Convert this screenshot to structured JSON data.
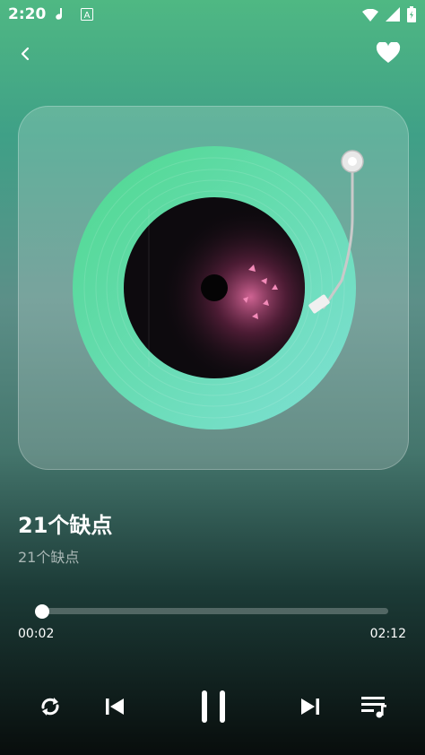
{
  "status_bar": {
    "time": "2:20",
    "icons": [
      "music-app-icon",
      "text-app-icon",
      "wifi-icon",
      "signal-icon",
      "battery-icon"
    ]
  },
  "header": {
    "back_icon": "chevron-left-icon",
    "favorite_icon": "heart-icon",
    "favorited": true
  },
  "track": {
    "title": "21个缺点",
    "artist": "21个缺点"
  },
  "progress": {
    "elapsed": "00:02",
    "total": "02:12",
    "fraction": 0.015
  },
  "controls": {
    "repeat_icon": "repeat-icon",
    "previous_icon": "skip-previous-icon",
    "play_state": "playing",
    "pause_icon": "pause-icon",
    "next_icon": "skip-next-icon",
    "playlist_icon": "playlist-icon"
  },
  "colors": {
    "record": "#5fd6a6",
    "label": "#0d0a0e",
    "accent_pink": "#e56ea2"
  }
}
